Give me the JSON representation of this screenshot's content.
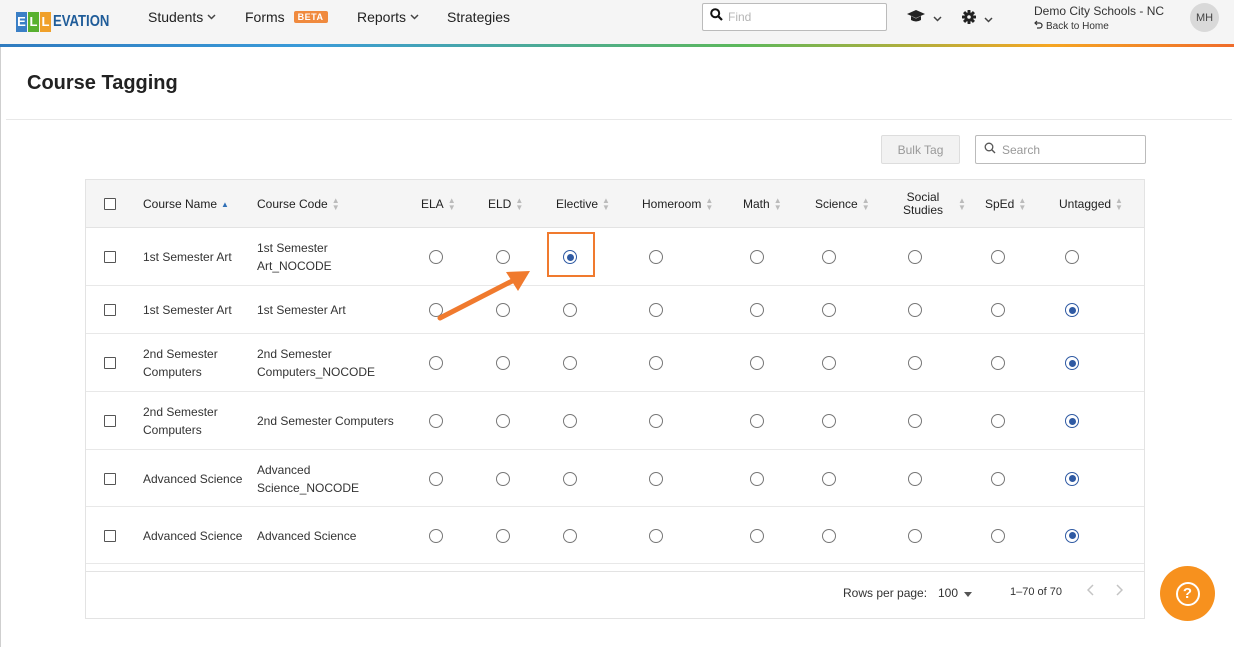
{
  "brand": {
    "logo_text": "ELLEVATION",
    "logo_letters": [
      "E",
      "L",
      "L"
    ],
    "logo_colors": [
      "#3a7fc6",
      "#58b030",
      "#f0a02a"
    ],
    "rest": "EVATION"
  },
  "nav": {
    "items": [
      {
        "label": "Students",
        "dropdown": true
      },
      {
        "label": "Forms",
        "badge": "BETA"
      },
      {
        "label": "Reports",
        "dropdown": true
      },
      {
        "label": "Strategies"
      }
    ],
    "find_placeholder": "Find",
    "district": "Demo City Schools - NC",
    "back_home": "Back to Home",
    "avatar_initials": "MH",
    "icons": [
      "graduation-cap-icon",
      "gear-icon"
    ]
  },
  "page": {
    "title": "Course Tagging"
  },
  "toolbar": {
    "bulk_tag_label": "Bulk Tag",
    "search_placeholder": "Search"
  },
  "table": {
    "columns": [
      {
        "label": "Course Name",
        "sort": "asc"
      },
      {
        "label": "Course Code"
      },
      {
        "label": "ELA"
      },
      {
        "label": "ELD"
      },
      {
        "label": "Elective"
      },
      {
        "label": "Homeroom"
      },
      {
        "label": "Math"
      },
      {
        "label": "Science"
      },
      {
        "label": "Social Studies"
      },
      {
        "label": "SpEd"
      },
      {
        "label": "Untagged"
      }
    ],
    "rows": [
      {
        "name": "1st Semester Art",
        "code": "1st Semester Art_NOCODE",
        "selected_tag": "Elective"
      },
      {
        "name": "1st Semester Art",
        "code": "1st Semester Art",
        "selected_tag": "Untagged"
      },
      {
        "name": "2nd Semester Computers",
        "code": "2nd Semester Computers_NOCODE",
        "selected_tag": "Untagged"
      },
      {
        "name": "2nd Semester Computers",
        "code": "2nd Semester Computers",
        "selected_tag": "Untagged"
      },
      {
        "name": "Advanced Science",
        "code": "Advanced Science_NOCODE",
        "selected_tag": "Untagged"
      },
      {
        "name": "Advanced Science",
        "code": "Advanced Science",
        "selected_tag": "Untagged"
      }
    ],
    "footer": {
      "rows_per_page_label": "Rows per page:",
      "rows_per_page_value": "100",
      "range": "1–70 of 70"
    }
  },
  "colors": {
    "accent_orange": "#f07a2e",
    "radio_selected": "#2f5aa3",
    "help_fab": "#f7911e"
  }
}
